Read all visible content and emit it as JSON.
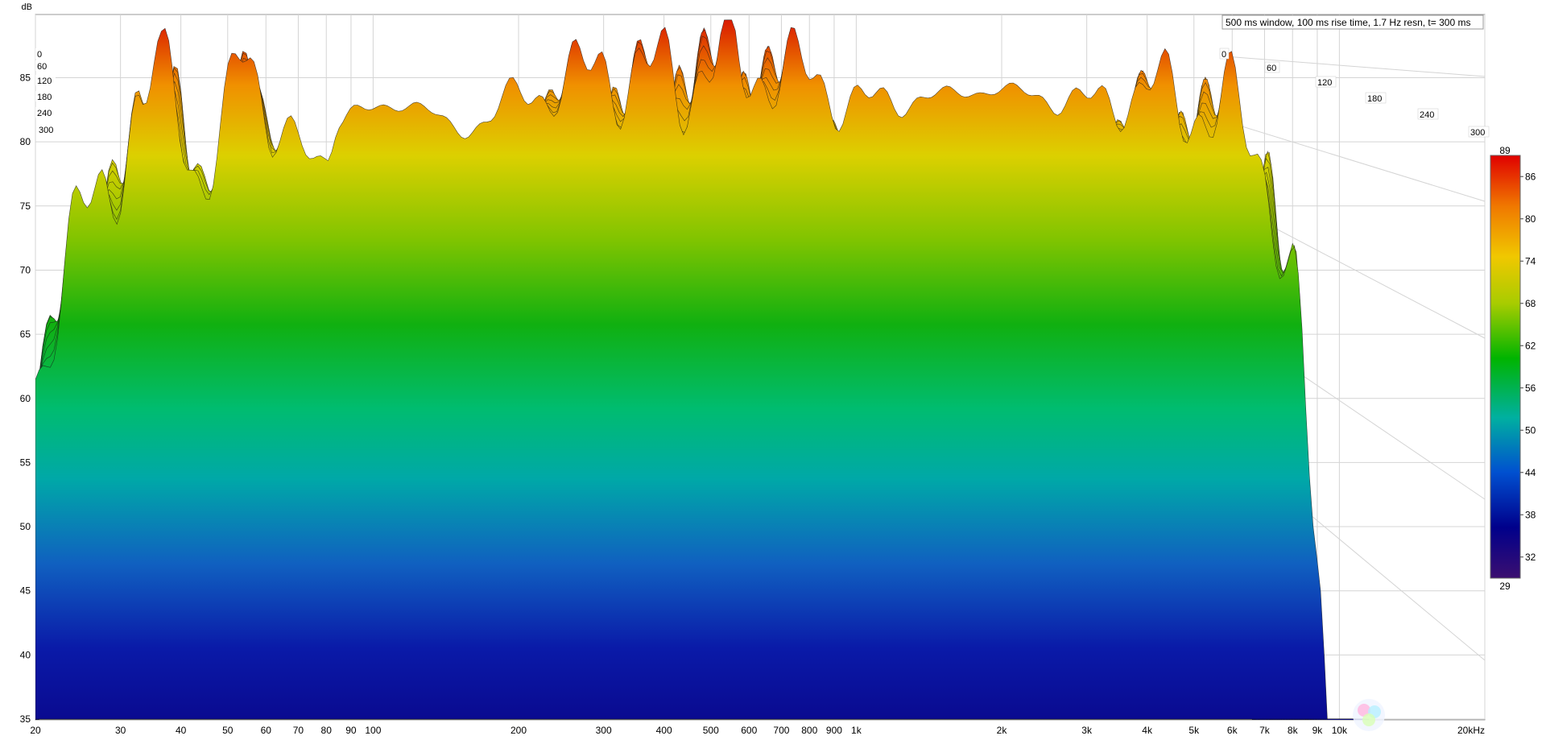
{
  "chart_data": {
    "type": "waterfall",
    "title": "500 ms window, 100 ms rise time,  1.7 Hz resn, t= 300 ms",
    "y_axis_label": "dB",
    "x_axis_unit": "kHz",
    "ylim": [
      35,
      90
    ],
    "y_ticks": [
      35,
      40,
      45,
      50,
      55,
      60,
      65,
      70,
      75,
      80,
      85
    ],
    "x_scale": "log",
    "xlim": [
      20,
      20000
    ],
    "x_ticks": [
      {
        "value": 20,
        "label": "20"
      },
      {
        "value": 30,
        "label": "30"
      },
      {
        "value": 40,
        "label": "40"
      },
      {
        "value": 50,
        "label": "50"
      },
      {
        "value": 60,
        "label": "60"
      },
      {
        "value": 70,
        "label": "70"
      },
      {
        "value": 80,
        "label": "80"
      },
      {
        "value": 90,
        "label": "90"
      },
      {
        "value": 100,
        "label": "100"
      },
      {
        "value": 200,
        "label": "200"
      },
      {
        "value": 300,
        "label": "300"
      },
      {
        "value": 400,
        "label": "400"
      },
      {
        "value": 500,
        "label": "500"
      },
      {
        "value": 600,
        "label": "600"
      },
      {
        "value": 700,
        "label": "700"
      },
      {
        "value": 800,
        "label": "800"
      },
      {
        "value": 900,
        "label": "900"
      },
      {
        "value": 1000,
        "label": "1k"
      },
      {
        "value": 2000,
        "label": "2k"
      },
      {
        "value": 3000,
        "label": "3k"
      },
      {
        "value": 4000,
        "label": "4k"
      },
      {
        "value": 5000,
        "label": "5k"
      },
      {
        "value": 6000,
        "label": "6k"
      },
      {
        "value": 7000,
        "label": "7k"
      },
      {
        "value": 8000,
        "label": "8k"
      },
      {
        "value": 9000,
        "label": "9k"
      },
      {
        "value": 10000,
        "label": "10k"
      },
      {
        "value": 20000,
        "label": "20kHz"
      }
    ],
    "time_ticks_ms": [
      0,
      60,
      120,
      180,
      240,
      300
    ],
    "time_labels_left": [
      "0",
      "60",
      "120",
      "180",
      "240",
      "300"
    ],
    "time_labels_right": [
      "0",
      "60",
      "120",
      "180",
      "240",
      "300"
    ],
    "colorbar": {
      "min": 29,
      "max": 89,
      "ticks": [
        86,
        80,
        74,
        68,
        62,
        56,
        50,
        44,
        38,
        32
      ],
      "min_label": "29",
      "max_label": "89"
    },
    "front_slice_peaks": [
      {
        "freq": 20,
        "db": 63
      },
      {
        "freq": 28,
        "db": 78
      },
      {
        "freq": 33,
        "db": 80
      },
      {
        "freq": 36,
        "db": 86
      },
      {
        "freq": 38,
        "db": 87
      },
      {
        "freq": 45,
        "db": 75
      },
      {
        "freq": 55,
        "db": 89
      },
      {
        "freq": 62,
        "db": 80
      },
      {
        "freq": 80,
        "db": 79
      },
      {
        "freq": 85,
        "db": 82
      },
      {
        "freq": 120,
        "db": 83
      },
      {
        "freq": 150,
        "db": 81
      },
      {
        "freq": 220,
        "db": 84
      },
      {
        "freq": 270,
        "db": 85
      },
      {
        "freq": 300,
        "db": 86
      },
      {
        "freq": 350,
        "db": 85
      },
      {
        "freq": 600,
        "db": 86
      },
      {
        "freq": 800,
        "db": 85
      },
      {
        "freq": 1000,
        "db": 83
      },
      {
        "freq": 2000,
        "db": 84
      },
      {
        "freq": 3000,
        "db": 83
      },
      {
        "freq": 4000,
        "db": 84
      },
      {
        "freq": 5000,
        "db": 83
      },
      {
        "freq": 6000,
        "db": 82
      },
      {
        "freq": 7000,
        "db": 79
      },
      {
        "freq": 8000,
        "db": 68
      },
      {
        "freq": 9000,
        "db": 55
      },
      {
        "freq": 10000,
        "db": 42
      },
      {
        "freq": 11000,
        "db": 36
      }
    ]
  },
  "colors": {
    "background": "#ffffff",
    "plot_background": "#ffffff",
    "grid": "#c8c8c8",
    "frame": "#999999",
    "colormap": [
      "#3b0f70",
      "#00008b",
      "#0050d0",
      "#00b0a0",
      "#00b400",
      "#c8d200",
      "#f0c800",
      "#f07800",
      "#e00000"
    ]
  }
}
